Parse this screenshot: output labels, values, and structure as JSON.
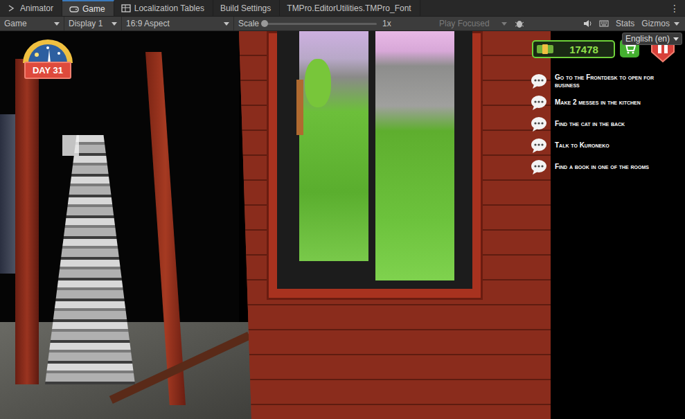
{
  "editor_tabs": [
    {
      "label": "Animator",
      "selected": false
    },
    {
      "label": "Game",
      "selected": true
    },
    {
      "label": "Localization Tables",
      "selected": false
    },
    {
      "label": "Build Settings",
      "selected": false
    },
    {
      "label": "TMPro.EditorUtilities.TMPro_Font",
      "selected": false
    }
  ],
  "tab_menu": "⋮",
  "toolbar": {
    "view": "Game",
    "display": "Display 1",
    "aspect": "16:9 Aspect",
    "scale_label": "Scale",
    "scale_level": 0,
    "scale_value": "1x",
    "play_mode": {
      "label": "Play Focused",
      "disabled": true
    },
    "stats": "Stats",
    "gizmos": "Gizmos"
  },
  "hud": {
    "day": "DAY 31",
    "money": "17478",
    "language": "English (en)",
    "quests": [
      "Go to the Frontdesk to open for business",
      "Make 2 messes in the kitchen",
      "Find the cat in the back",
      "Talk to Kuroneko",
      "Find a book in one of the rooms"
    ]
  }
}
